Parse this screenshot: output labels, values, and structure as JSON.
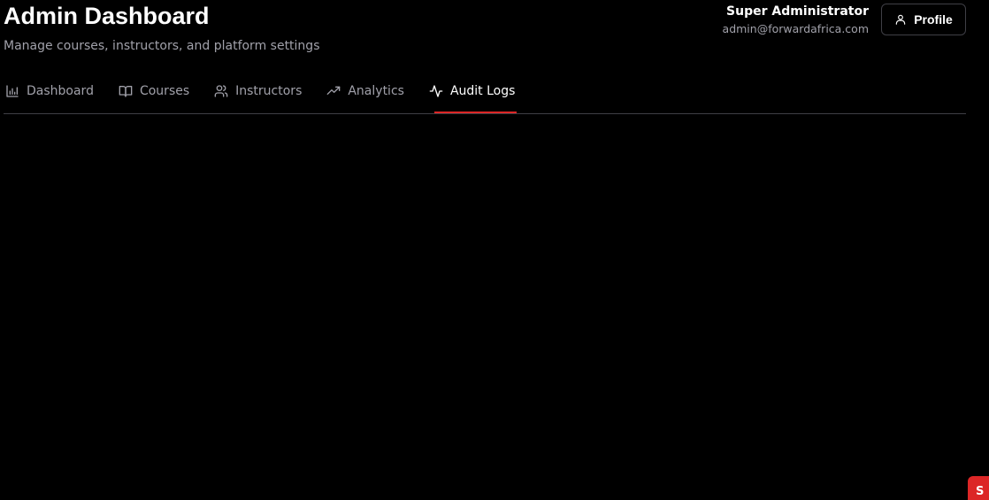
{
  "header": {
    "title": "Admin Dashboard",
    "subtitle": "Manage courses, instructors, and platform settings"
  },
  "user": {
    "name": "Super Administrator",
    "email": "admin@forwardafrica.com"
  },
  "profile_button": {
    "label": "Profile",
    "icon": "user-icon"
  },
  "tabs": [
    {
      "label": "Dashboard",
      "icon": "bar-chart-icon",
      "active": false
    },
    {
      "label": "Courses",
      "icon": "book-open-icon",
      "active": false
    },
    {
      "label": "Instructors",
      "icon": "users-icon",
      "active": false
    },
    {
      "label": "Analytics",
      "icon": "trending-up-icon",
      "active": false
    },
    {
      "label": "Audit Logs",
      "icon": "activity-icon",
      "active": true
    }
  ],
  "corner_toast": {
    "label": "S"
  },
  "colors": {
    "background": "#000000",
    "accent": "#dc2626",
    "muted_text": "#a1a1aa",
    "border": "#3f3f46"
  }
}
